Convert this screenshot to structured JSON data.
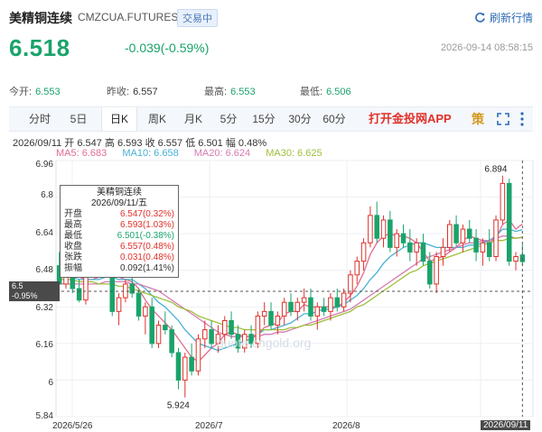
{
  "header": {
    "name": "美精铜连续",
    "code": "CMZCUA.FUTURES",
    "status": "交易中",
    "refresh_label": "刷新行情",
    "price": "6.518",
    "change": "-0.039(-0.59%)",
    "datetime": "2026-09-14 08:58:15"
  },
  "stats": {
    "open_label": "今开:",
    "open": "6.553",
    "prev_label": "昨收:",
    "prev": "6.557",
    "high_label": "最高:",
    "high": "6.553",
    "low_label": "最低:",
    "low": "6.506"
  },
  "tabs": {
    "items": [
      "分时",
      "5日",
      "日K",
      "周K",
      "月K",
      "5分",
      "15分",
      "30分",
      "60分"
    ],
    "active_index": 2,
    "app_link": "打开金投网APP",
    "strategy_icon_text": "策"
  },
  "info": {
    "ohlc_line": "2026/09/11  开 6.547  高 6.593  收 6.557  低 6.501  幅 0.48%",
    "ma5": "MA5: 6.683",
    "ma10": "MA10: 6.658",
    "ma20": "MA20: 6.624",
    "ma30": "MA30: 6.625"
  },
  "tooltip": {
    "title": "美精铜连续",
    "date": "2026/09/11/五",
    "rows": [
      {
        "label": "开盘",
        "value": "6.547(0.32%)",
        "dir": "up"
      },
      {
        "label": "最高",
        "value": "6.593(1.03%)",
        "dir": "up"
      },
      {
        "label": "最低",
        "value": "6.501(-0.38%)",
        "dir": "down"
      },
      {
        "label": "收盘",
        "value": "6.557(0.48%)",
        "dir": "up"
      },
      {
        "label": "张跌",
        "value": "0.031(0.48%)",
        "dir": "up"
      },
      {
        "label": "振幅",
        "value": "0.092(1.41%)",
        "dir": "flat"
      }
    ]
  },
  "cursor_tag": {
    "line1": "6.5",
    "line2": "-0.95%"
  },
  "watermark": "quote.cngold.org",
  "colors": {
    "up": "#e0312a",
    "down": "#1aa36b",
    "ma5": "#e06d8f",
    "ma10": "#48b0d6",
    "ma20": "#d67bb3",
    "ma30": "#9fbf3b"
  },
  "chart_data": {
    "type": "candlestick",
    "title": "",
    "ylim": [
      5.84,
      6.96
    ],
    "y_ticks": [
      "6.96",
      "6.8",
      "6.64",
      "6.48",
      "6.32",
      "6.16",
      "6",
      "5.84"
    ],
    "x_tick_labels": [
      "2026/5/26",
      "2026/7",
      "2026/8",
      "2026/09/11"
    ],
    "annotations": [
      {
        "label": "6.894",
        "at": "max"
      },
      {
        "label": "5.924",
        "at": "min"
      }
    ],
    "candles": [
      [
        6.5,
        6.56,
        6.45,
        6.42
      ],
      [
        6.42,
        6.5,
        6.4,
        6.48
      ],
      [
        6.48,
        6.52,
        6.38,
        6.4
      ],
      [
        6.4,
        6.44,
        6.34,
        6.35
      ],
      [
        6.35,
        6.5,
        6.33,
        6.47
      ],
      [
        6.47,
        6.55,
        6.45,
        6.52
      ],
      [
        6.52,
        6.58,
        6.48,
        6.56
      ],
      [
        6.56,
        6.6,
        6.5,
        6.52
      ],
      [
        6.52,
        6.54,
        6.28,
        6.3
      ],
      [
        6.3,
        6.38,
        6.24,
        6.36
      ],
      [
        6.36,
        6.44,
        6.34,
        6.42
      ],
      [
        6.42,
        6.46,
        6.36,
        6.38
      ],
      [
        6.38,
        6.4,
        6.26,
        6.28
      ],
      [
        6.28,
        6.34,
        6.2,
        6.32
      ],
      [
        6.32,
        6.36,
        6.14,
        6.16
      ],
      [
        6.16,
        6.26,
        6.14,
        6.24
      ],
      [
        6.24,
        6.3,
        6.2,
        6.22
      ],
      [
        6.22,
        6.24,
        6.1,
        6.12
      ],
      [
        6.12,
        6.14,
        5.96,
        6.0
      ],
      [
        6.0,
        6.12,
        5.924,
        6.1
      ],
      [
        6.1,
        6.16,
        6.02,
        6.04
      ],
      [
        6.04,
        6.2,
        6.02,
        6.18
      ],
      [
        6.18,
        6.26,
        6.14,
        6.22
      ],
      [
        6.22,
        6.26,
        6.14,
        6.16
      ],
      [
        6.16,
        6.24,
        6.12,
        6.2
      ],
      [
        6.2,
        6.28,
        6.16,
        6.26
      ],
      [
        6.26,
        6.3,
        6.18,
        6.2
      ],
      [
        6.2,
        6.24,
        6.12,
        6.14
      ],
      [
        6.14,
        6.22,
        6.12,
        6.2
      ],
      [
        6.2,
        6.24,
        6.14,
        6.16
      ],
      [
        6.16,
        6.3,
        6.14,
        6.28
      ],
      [
        6.28,
        6.34,
        6.24,
        6.3
      ],
      [
        6.3,
        6.34,
        6.22,
        6.24
      ],
      [
        6.24,
        6.3,
        6.2,
        6.28
      ],
      [
        6.28,
        6.36,
        6.24,
        6.34
      ],
      [
        6.34,
        6.38,
        6.28,
        6.3
      ],
      [
        6.3,
        6.36,
        6.26,
        6.34
      ],
      [
        6.34,
        6.4,
        6.3,
        6.36
      ],
      [
        6.36,
        6.4,
        6.26,
        6.28
      ],
      [
        6.28,
        6.34,
        6.22,
        6.32
      ],
      [
        6.32,
        6.36,
        6.28,
        6.3
      ],
      [
        6.3,
        6.38,
        6.26,
        6.36
      ],
      [
        6.36,
        6.4,
        6.3,
        6.32
      ],
      [
        6.32,
        6.4,
        6.3,
        6.38
      ],
      [
        6.38,
        6.48,
        6.34,
        6.46
      ],
      [
        6.46,
        6.54,
        6.42,
        6.52
      ],
      [
        6.52,
        6.62,
        6.48,
        6.6
      ],
      [
        6.6,
        6.76,
        6.58,
        6.72
      ],
      [
        6.72,
        6.78,
        6.6,
        6.62
      ],
      [
        6.62,
        6.72,
        6.58,
        6.7
      ],
      [
        6.7,
        6.74,
        6.56,
        6.58
      ],
      [
        6.58,
        6.66,
        6.54,
        6.64
      ],
      [
        6.64,
        6.68,
        6.58,
        6.6
      ],
      [
        6.6,
        6.66,
        6.52,
        6.56
      ],
      [
        6.56,
        6.62,
        6.5,
        6.6
      ],
      [
        6.6,
        6.64,
        6.5,
        6.52
      ],
      [
        6.52,
        6.56,
        6.4,
        6.42
      ],
      [
        6.42,
        6.56,
        6.38,
        6.54
      ],
      [
        6.54,
        6.62,
        6.5,
        6.58
      ],
      [
        6.58,
        6.7,
        6.56,
        6.68
      ],
      [
        6.68,
        6.72,
        6.58,
        6.6
      ],
      [
        6.6,
        6.68,
        6.56,
        6.66
      ],
      [
        6.66,
        6.7,
        6.6,
        6.62
      ],
      [
        6.62,
        6.66,
        6.52,
        6.56
      ],
      [
        6.56,
        6.62,
        6.5,
        6.6
      ],
      [
        6.6,
        6.66,
        6.52,
        6.54
      ],
      [
        6.54,
        6.72,
        6.52,
        6.7
      ],
      [
        6.7,
        6.894,
        6.68,
        6.86
      ],
      [
        6.86,
        6.88,
        6.5,
        6.52
      ],
      [
        6.52,
        6.56,
        6.48,
        6.54
      ],
      [
        6.547,
        6.593,
        6.501,
        6.518
      ]
    ],
    "ma_series": [
      {
        "name": "MA5",
        "values": [
          6.48,
          6.47,
          6.46,
          6.45,
          6.44,
          6.44,
          6.45,
          6.47,
          6.47,
          6.45,
          6.44,
          6.43,
          6.4,
          6.35,
          6.31,
          6.28,
          6.25,
          6.22,
          6.18,
          6.14,
          6.1,
          6.08,
          6.11,
          6.14,
          6.16,
          6.2,
          6.21,
          6.2,
          6.19,
          6.19,
          6.2,
          6.23,
          6.24,
          6.25,
          6.29,
          6.3,
          6.3,
          6.33,
          6.32,
          6.32,
          6.32,
          6.32,
          6.32,
          6.34,
          6.37,
          6.41,
          6.47,
          6.55,
          6.6,
          6.63,
          6.64,
          6.63,
          6.63,
          6.62,
          6.6,
          6.56,
          6.52,
          6.53,
          6.54,
          6.56,
          6.58,
          6.61,
          6.63,
          6.62,
          6.61,
          6.6,
          6.62,
          6.68,
          6.7,
          6.66,
          6.683
        ]
      },
      {
        "name": "MA10",
        "values": [
          6.45,
          6.45,
          6.45,
          6.44,
          6.44,
          6.44,
          6.44,
          6.45,
          6.45,
          6.44,
          6.44,
          6.44,
          6.42,
          6.4,
          6.37,
          6.34,
          6.32,
          6.29,
          6.26,
          6.22,
          6.19,
          6.16,
          6.15,
          6.14,
          6.13,
          6.14,
          6.15,
          6.16,
          6.17,
          6.18,
          6.2,
          6.22,
          6.22,
          6.23,
          6.24,
          6.25,
          6.27,
          6.29,
          6.29,
          6.3,
          6.31,
          6.31,
          6.32,
          6.33,
          6.35,
          6.37,
          6.4,
          6.44,
          6.47,
          6.51,
          6.54,
          6.56,
          6.58,
          6.59,
          6.6,
          6.6,
          6.59,
          6.58,
          6.58,
          6.58,
          6.58,
          6.58,
          6.59,
          6.59,
          6.6,
          6.61,
          6.63,
          6.66,
          6.66,
          6.65,
          6.658
        ]
      },
      {
        "name": "MA20",
        "values": [
          6.42,
          6.42,
          6.42,
          6.42,
          6.42,
          6.42,
          6.42,
          6.43,
          6.43,
          6.43,
          6.43,
          6.42,
          6.42,
          6.41,
          6.4,
          6.39,
          6.37,
          6.35,
          6.33,
          6.31,
          6.29,
          6.27,
          6.25,
          6.23,
          6.21,
          6.2,
          6.19,
          6.19,
          6.19,
          6.19,
          6.19,
          6.2,
          6.2,
          6.21,
          6.21,
          6.22,
          6.23,
          6.24,
          6.25,
          6.26,
          6.27,
          6.28,
          6.29,
          6.3,
          6.31,
          6.33,
          6.35,
          6.37,
          6.39,
          6.41,
          6.43,
          6.45,
          6.47,
          6.49,
          6.51,
          6.53,
          6.54,
          6.55,
          6.56,
          6.57,
          6.58,
          6.59,
          6.6,
          6.6,
          6.61,
          6.61,
          6.62,
          6.63,
          6.63,
          6.62,
          6.624
        ]
      },
      {
        "name": "MA30",
        "values": [
          6.44,
          6.44,
          6.44,
          6.43,
          6.43,
          6.43,
          6.42,
          6.42,
          6.42,
          6.41,
          6.41,
          6.4,
          6.39,
          6.38,
          6.37,
          6.36,
          6.35,
          6.34,
          6.32,
          6.31,
          6.3,
          6.28,
          6.27,
          6.26,
          6.25,
          6.24,
          6.23,
          6.23,
          6.22,
          6.22,
          6.22,
          6.22,
          6.22,
          6.22,
          6.22,
          6.23,
          6.23,
          6.24,
          6.24,
          6.25,
          6.26,
          6.27,
          6.28,
          6.29,
          6.3,
          6.32,
          6.33,
          6.35,
          6.37,
          6.39,
          6.41,
          6.43,
          6.45,
          6.47,
          6.48,
          6.5,
          6.51,
          6.52,
          6.53,
          6.54,
          6.55,
          6.56,
          6.57,
          6.58,
          6.59,
          6.6,
          6.61,
          6.61,
          6.62,
          6.62,
          6.625
        ]
      }
    ]
  }
}
